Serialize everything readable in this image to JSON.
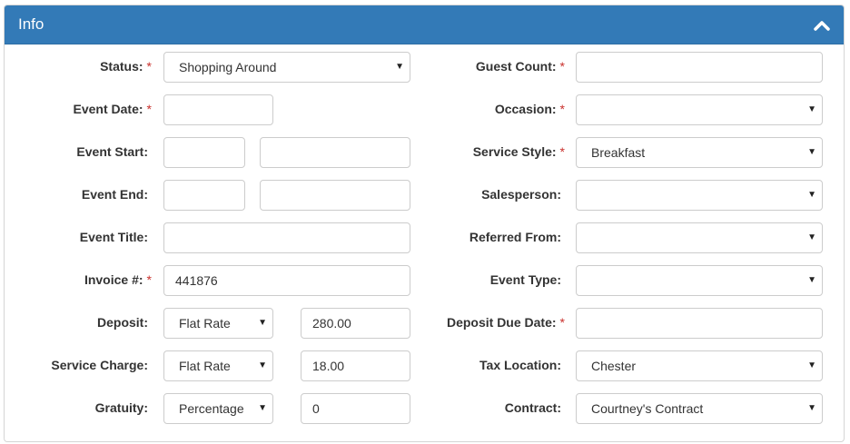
{
  "panel": {
    "title": "Info"
  },
  "left": {
    "status_label": "Status:",
    "status_value": "Shopping Around",
    "event_date_label": "Event Date:",
    "event_date_value": "",
    "event_start_label": "Event Start:",
    "event_start_date": "",
    "event_start_time": "",
    "event_end_label": "Event End:",
    "event_end_date": "",
    "event_end_time": "",
    "event_title_label": "Event Title:",
    "event_title_value": "",
    "invoice_label": "Invoice #:",
    "invoice_value": "441876",
    "deposit_label": "Deposit:",
    "deposit_type": "Flat Rate",
    "deposit_amount": "280.00",
    "service_charge_label": "Service Charge:",
    "service_charge_type": "Flat Rate",
    "service_charge_amount": "18.00",
    "gratuity_label": "Gratuity:",
    "gratuity_type": "Percentage",
    "gratuity_amount": "0"
  },
  "right": {
    "guest_count_label": "Guest Count:",
    "guest_count_value": "",
    "occasion_label": "Occasion:",
    "occasion_value": "",
    "service_style_label": "Service Style:",
    "service_style_value": "Breakfast",
    "salesperson_label": "Salesperson:",
    "salesperson_value": "",
    "referred_from_label": "Referred From:",
    "referred_from_value": "",
    "event_type_label": "Event Type:",
    "event_type_value": "",
    "deposit_due_date_label": "Deposit Due Date:",
    "deposit_due_date_value": "",
    "tax_location_label": "Tax Location:",
    "tax_location_value": "Chester",
    "contract_label": "Contract:",
    "contract_value": "Courtney's Contract"
  },
  "required_marker": "*",
  "dropdown_arrow": "▼",
  "colors": {
    "header": "#337ab7",
    "required": "#c9302c"
  }
}
